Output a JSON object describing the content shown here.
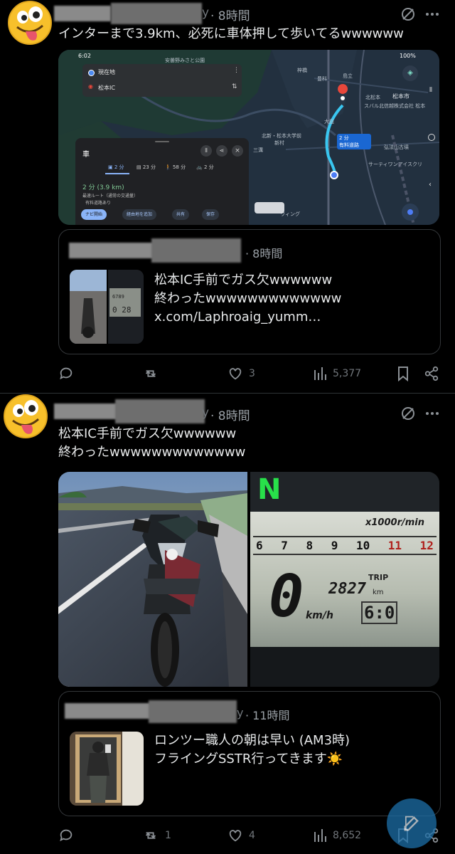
{
  "tweet1": {
    "time": "· 8時間",
    "name_suffix": "y",
    "text": "インターまで3.9km、必死に車体押して歩いてるwwwwww",
    "map": {
      "status_time": "6:02",
      "battery": "100%",
      "origin": "現在地",
      "destination": "松本IC",
      "mode_title": "車",
      "tabs": [
        "2 分",
        "23 分",
        "58 分",
        "2 分"
      ],
      "duration": "2 分 (3.9 km)",
      "route_desc": "最速ルート（通常の交通量）",
      "toll": "有料道路あり",
      "btn_navi": "ナビ開始",
      "btn_waypoint": "経由地を追加",
      "btn_share": "共有",
      "btn_save": "保存",
      "callout_time": "2 分",
      "callout_label": "有料道路",
      "place_labels": [
        "安曇野みさと公園",
        "梓橋",
        "島立",
        "豊科",
        "北松本",
        "松本市",
        "スバル北信越株式会社 松本",
        "大庭",
        "北新・松本大学前",
        "新村",
        "三溝",
        "弘法山古墳",
        "サーティワンアイスクリ",
        "ウィング"
      ]
    },
    "quote": {
      "time": "· 8時間",
      "text_line1": "松本IC手前でガス欠wwwwww",
      "text_line2": "終わったwwwwwwwwwwwww",
      "link": "x.com/Laphroaig_yumm…"
    },
    "actions": {
      "likes": "3",
      "views": "5,377"
    }
  },
  "tweet2": {
    "time": "· 8時間",
    "name_suffix": "y",
    "text_line1": "松本IC手前でガス欠wwwwww",
    "text_line2": "終わったwwwwwwwwwwwww",
    "photo_right": {
      "gear": "N",
      "rpm_unit": "x1000r/min",
      "rpm_scale": [
        "6",
        "7",
        "8",
        "9",
        "10",
        "11",
        "12"
      ],
      "trip": "TRIP",
      "odometer": "2827",
      "odo_unit": "km",
      "speed": "0",
      "speed_unit": "km/h",
      "clock": "6:0"
    },
    "quote": {
      "time": "· 11時間",
      "name_suffix": "y",
      "text_line1": "ロンツー職人の朝は早い (AM3時)",
      "text_line2": "フライングSSTR行ってきます☀️"
    },
    "actions": {
      "retweets": "1",
      "likes": "4",
      "views": "8,652"
    }
  },
  "colors": {
    "accent": "#1d9bf0",
    "muted": "#71767b",
    "border": "#333639"
  }
}
